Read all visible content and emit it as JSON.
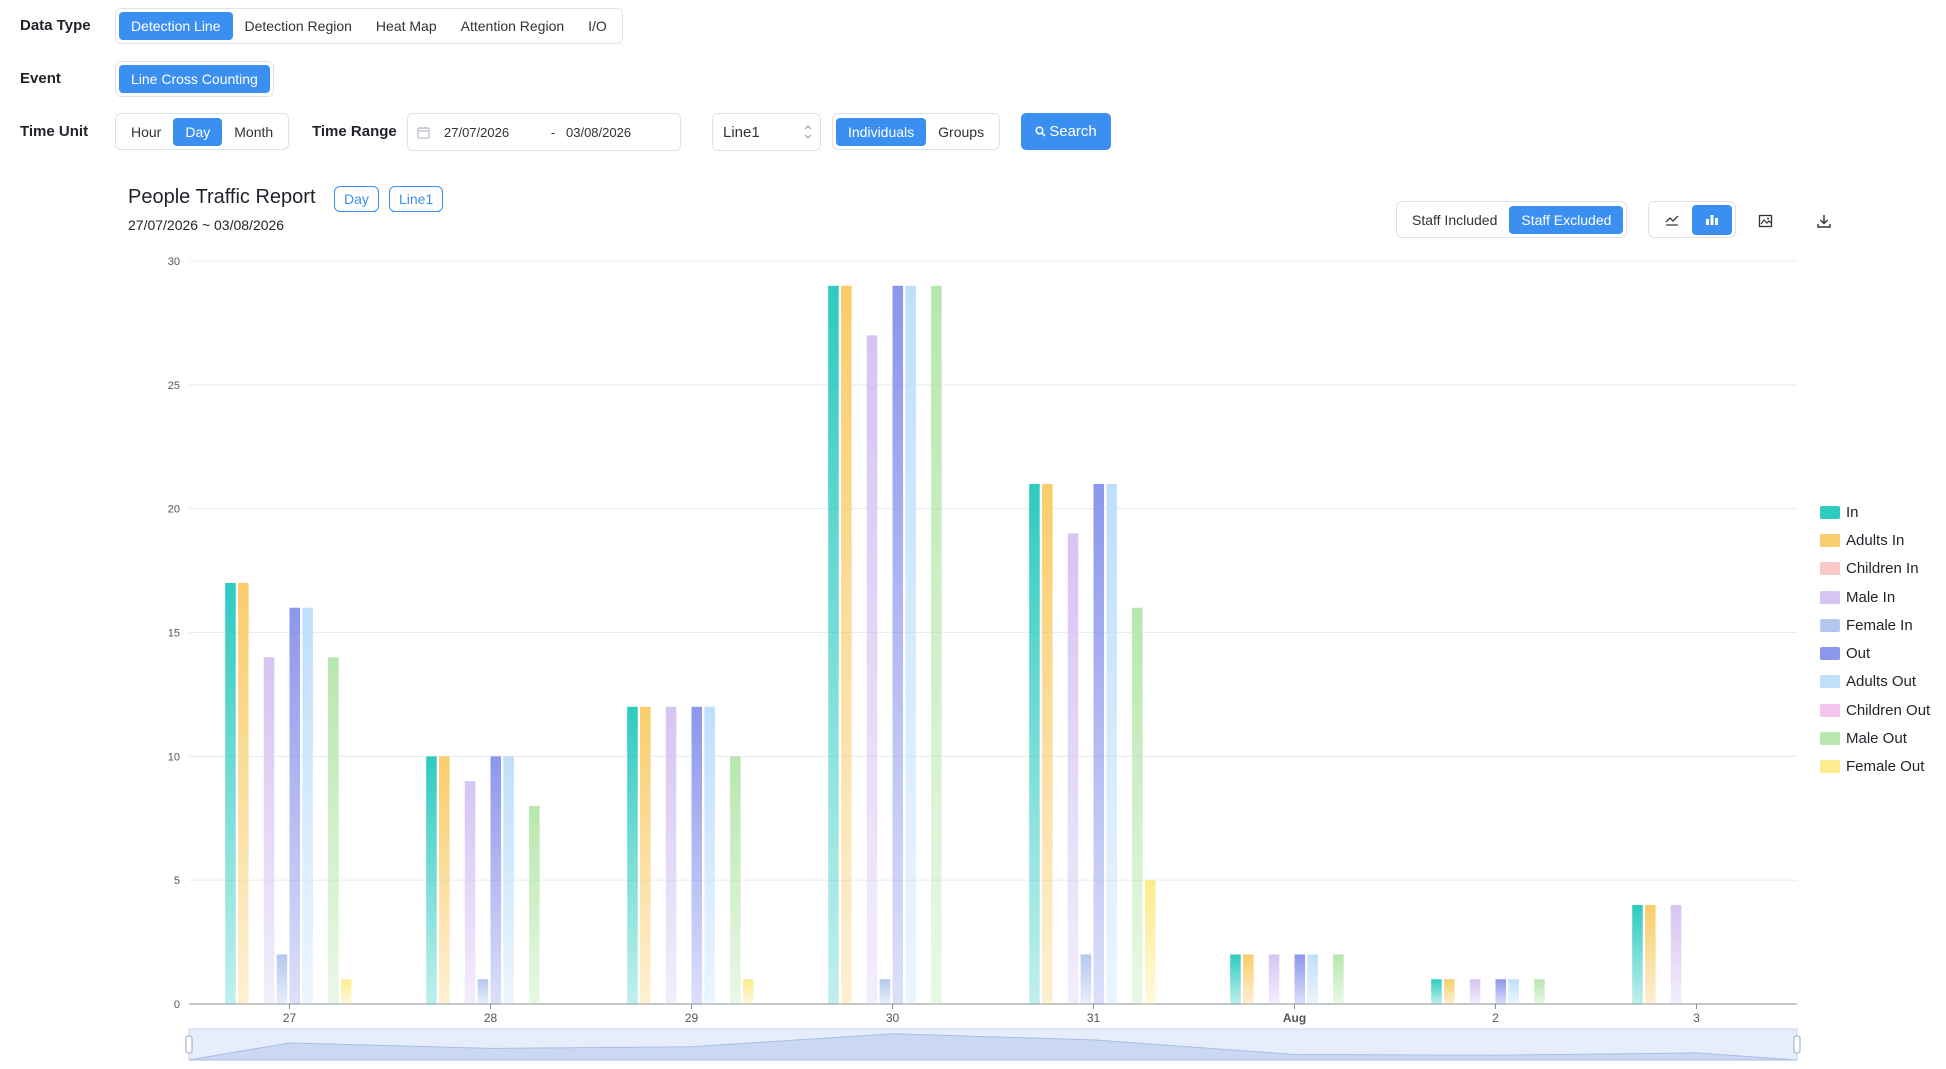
{
  "filters": {
    "data_type_label": "Data Type",
    "data_type_options": [
      "Detection Line",
      "Detection Region",
      "Heat Map",
      "Attention Region",
      "I/O"
    ],
    "event_label": "Event",
    "event_options": [
      "Line Cross Counting"
    ],
    "time_unit_label": "Time Unit",
    "time_unit_options": [
      "Hour",
      "Day",
      "Month"
    ],
    "time_range_label": "Time Range",
    "date_start": "27/07/2026",
    "date_separator": "-",
    "date_end": "03/08/2026",
    "line_select_value": "Line1",
    "mode_options": [
      "Individuals",
      "Groups"
    ],
    "search_label": "Search"
  },
  "report": {
    "title": "People Traffic Report",
    "tag_unit": "Day",
    "tag_line": "Line1",
    "date_range": "27/07/2026 ~ 03/08/2026",
    "staff_options": [
      "Staff Included",
      "Staff Excluded"
    ]
  },
  "icons": {
    "calendar": "calendar-icon",
    "select": "up-down-chevron-icon",
    "search": "search-icon",
    "line_chart": "line-chart-icon",
    "bar_chart": "bar-chart-icon",
    "save_image": "image-save-icon",
    "download": "download-icon"
  },
  "colors": {
    "accent": "#3b8ff0",
    "In": "#2ecbc0",
    "Adults In": "#f9cd6b",
    "Children In": "#f9c9c9",
    "Male In": "#d6c4f2",
    "Female In": "#b4c7ef",
    "Out": "#8c96ec",
    "Adults Out": "#bfdffb",
    "Children Out": "#f6c3ee",
    "Male Out": "#b7e7ad",
    "Female Out": "#fbec8d"
  },
  "chart_data": {
    "type": "bar",
    "categories": [
      "27",
      "28",
      "29",
      "30",
      "31",
      "Aug",
      "2",
      "3"
    ],
    "ylim": [
      0,
      30
    ],
    "yticks": [
      0,
      5,
      10,
      15,
      20,
      25,
      30
    ],
    "grid": true,
    "legend_position": "right",
    "series": [
      {
        "name": "In",
        "values": [
          17,
          10,
          12,
          29,
          21,
          2,
          1,
          4
        ]
      },
      {
        "name": "Adults In",
        "values": [
          17,
          10,
          12,
          29,
          21,
          2,
          1,
          4
        ]
      },
      {
        "name": "Children In",
        "values": [
          0,
          0,
          0,
          0,
          0,
          0,
          0,
          0
        ]
      },
      {
        "name": "Male In",
        "values": [
          14,
          9,
          12,
          27,
          19,
          2,
          1,
          4
        ]
      },
      {
        "name": "Female In",
        "values": [
          2,
          1,
          0,
          1,
          2,
          0,
          0,
          0
        ]
      },
      {
        "name": "Out",
        "values": [
          16,
          10,
          12,
          29,
          21,
          2,
          1,
          0
        ]
      },
      {
        "name": "Adults Out",
        "values": [
          16,
          10,
          12,
          29,
          21,
          2,
          1,
          0
        ]
      },
      {
        "name": "Children Out",
        "values": [
          0,
          0,
          0,
          0,
          0,
          0,
          0,
          0
        ]
      },
      {
        "name": "Male Out",
        "values": [
          14,
          8,
          10,
          29,
          16,
          2,
          1,
          0
        ]
      },
      {
        "name": "Female Out",
        "values": [
          1,
          0,
          1,
          0,
          5,
          0,
          0,
          0
        ]
      }
    ]
  }
}
